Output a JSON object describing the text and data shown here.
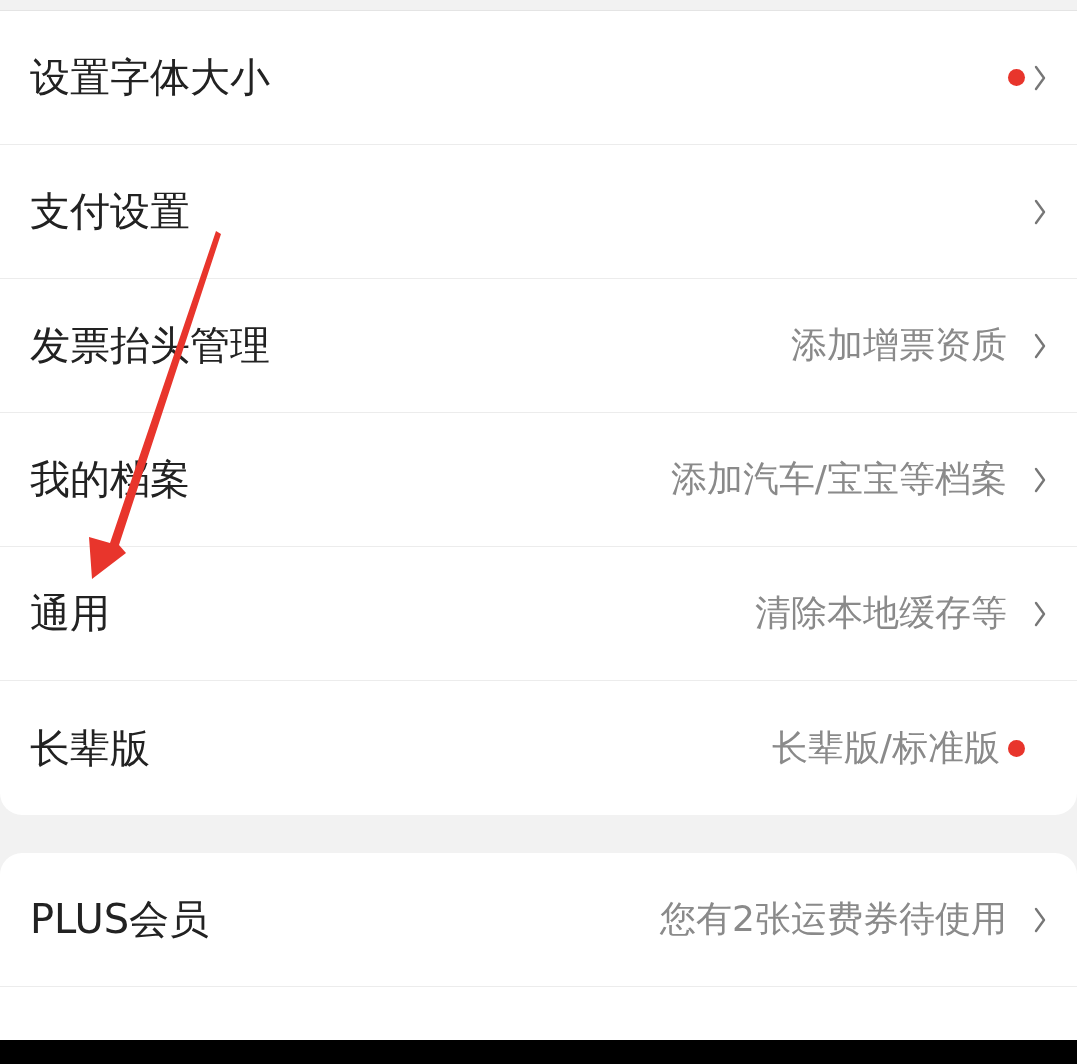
{
  "groups": [
    {
      "items": [
        {
          "label": "设置字体大小",
          "red_dot": true,
          "chevron": true
        },
        {
          "label": "支付设置",
          "red_dot": false,
          "chevron": true
        },
        {
          "label": "发票抬头管理",
          "value": "添加增票资质",
          "red_dot": false,
          "chevron": true
        },
        {
          "label": "我的档案",
          "value": "添加汽车/宝宝等档案",
          "red_dot": false,
          "chevron": true
        },
        {
          "label": "通用",
          "value": "清除本地缓存等",
          "red_dot": false,
          "chevron": true
        },
        {
          "label": "长辈版",
          "value": "长辈版/标准版",
          "red_dot": true,
          "chevron": false
        }
      ]
    },
    {
      "items": [
        {
          "label": "PLUS会员",
          "value": "您有2张运费券待使用",
          "red_dot": false,
          "chevron": true
        }
      ]
    }
  ],
  "annotations": [
    {
      "kind": "arrow",
      "color": "#e8352c"
    }
  ]
}
